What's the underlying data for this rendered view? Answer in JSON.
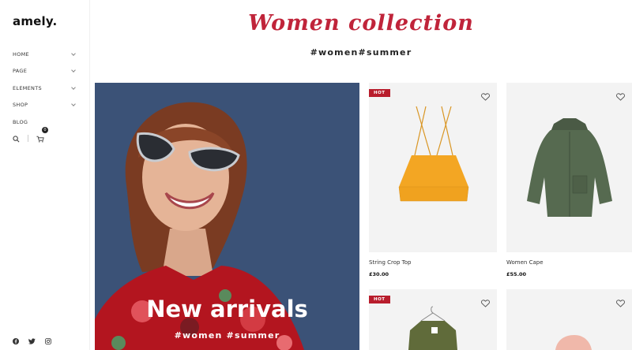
{
  "brand": {
    "logo": "amely."
  },
  "nav": {
    "items": [
      {
        "label": "HOME"
      },
      {
        "label": "PAGE"
      },
      {
        "label": "ELEMENTS"
      },
      {
        "label": "SHOP"
      },
      {
        "label": "BLOG"
      }
    ],
    "cart_count": "0"
  },
  "header": {
    "title": "Women collection",
    "hashtags": "#women#summer"
  },
  "banner": {
    "title": "New arrivals",
    "hashtags": "#women #summer"
  },
  "products": [
    {
      "badge": "HOT",
      "name": "String Crop Top",
      "price": "£30.00"
    },
    {
      "badge": "",
      "name": "Women Cape",
      "price": "£55.00"
    },
    {
      "badge": "HOT",
      "name": "",
      "price": ""
    },
    {
      "badge": "",
      "name": "",
      "price": ""
    }
  ],
  "icons": {
    "search": "search-icon",
    "cart": "cart-icon",
    "heart": "heart-icon",
    "facebook": "facebook-icon",
    "twitter": "twitter-icon",
    "instagram": "instagram-icon"
  },
  "colors": {
    "accent": "#c0243a",
    "badge": "#b81d2c",
    "banner_bg": "#3b5277"
  }
}
